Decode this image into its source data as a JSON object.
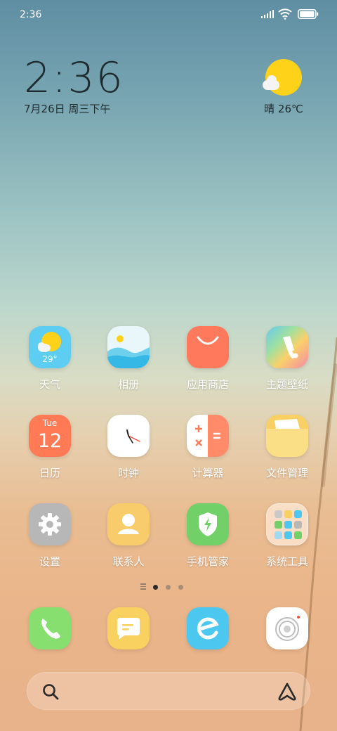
{
  "status_bar": {
    "time": "2:36"
  },
  "clock_widget": {
    "time": "2:36",
    "date": "7月26日 周三下午"
  },
  "weather_widget": {
    "condition": "晴",
    "temperature": "26℃",
    "icon": "sun-cloud-icon"
  },
  "weather_app_icon_temp": "29°",
  "calendar_icon": {
    "day_name": "Tue",
    "day_number": "12"
  },
  "apps": [
    {
      "label": "天气",
      "icon": "weather-icon"
    },
    {
      "label": "相册",
      "icon": "gallery-icon"
    },
    {
      "label": "应用商店",
      "icon": "app-store-icon"
    },
    {
      "label": "主题壁纸",
      "icon": "themes-icon"
    },
    {
      "label": "日历",
      "icon": "calendar-icon"
    },
    {
      "label": "时钟",
      "icon": "clock-icon"
    },
    {
      "label": "计算器",
      "icon": "calculator-icon"
    },
    {
      "label": "文件管理",
      "icon": "file-manager-icon"
    },
    {
      "label": "设置",
      "icon": "settings-icon"
    },
    {
      "label": "联系人",
      "icon": "contacts-icon"
    },
    {
      "label": "手机管家",
      "icon": "security-icon"
    },
    {
      "label": "系统工具",
      "icon": "system-tools-folder-icon"
    }
  ],
  "dock": [
    {
      "icon": "phone-icon"
    },
    {
      "icon": "messages-icon"
    },
    {
      "icon": "browser-icon"
    },
    {
      "icon": "camera-icon"
    }
  ],
  "pages": {
    "count": 3,
    "active": 1
  },
  "colors": {
    "weather_bg": "#5ecdf2",
    "app_store_bg": "#ff7a5c",
    "calendar_bg": "#ff7a55",
    "settings_bg": "#b7b7b7",
    "contacts_bg": "#f8cc6b",
    "security_bg": "#71d067",
    "phone_bg": "#86df6e",
    "messages_bg": "#f8d160",
    "browser_bg": "#4cc8f0",
    "sun": "#ffd21a"
  }
}
